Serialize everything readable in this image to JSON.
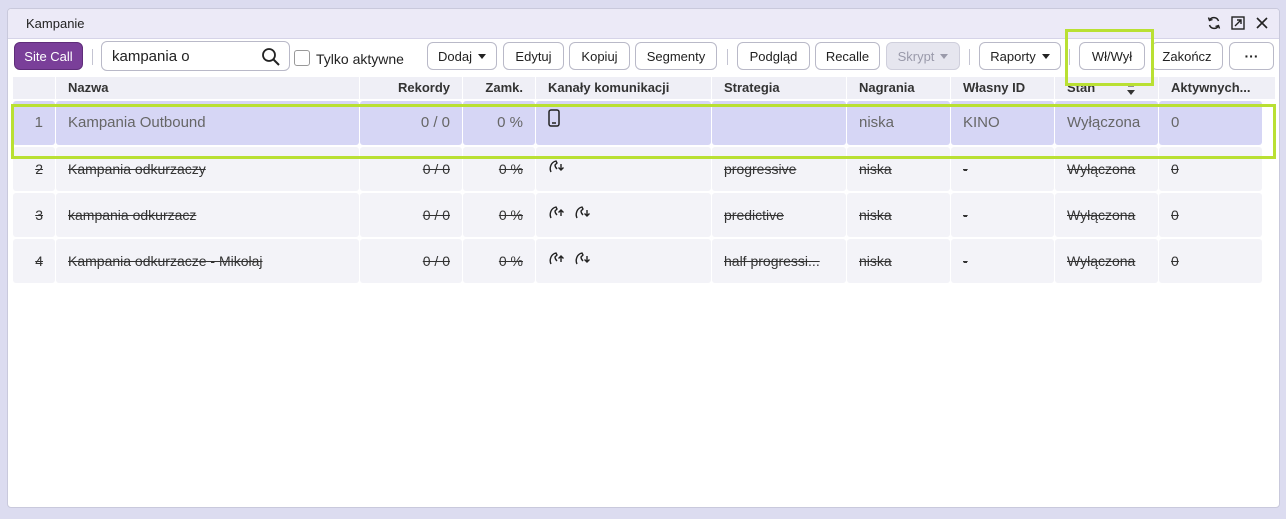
{
  "window": {
    "title": "Kampanie"
  },
  "window_controls": [
    "refresh-icon",
    "popout-icon",
    "close-icon"
  ],
  "toolbar": {
    "site_call": "Site Call",
    "search_value": "kampania o",
    "active_only_label": "Tylko aktywne",
    "add": "Dodaj",
    "edit": "Edytuj",
    "copy": "Kopiuj",
    "segments": "Segmenty",
    "preview": "Podgląd",
    "recalle": "Recalle",
    "script": "Skrypt",
    "reports": "Raporty",
    "onoff": "Wł/Wył",
    "finish": "Zakończ",
    "more": "···"
  },
  "columns": {
    "name": "Nazwa",
    "records": "Rekordy",
    "closed": "Zamk.",
    "channels": "Kanały komunikacji",
    "strategy": "Strategia",
    "recordings": "Nagrania",
    "own_id": "Własny ID",
    "state": "Stan",
    "active": "Aktywnych..."
  },
  "rows": [
    {
      "num": "1",
      "name": "Kampania Outbound",
      "records": "0 / 0",
      "closed": "0 %",
      "channels": [
        "mobile-icon"
      ],
      "strategy": "",
      "recordings": "niska",
      "own_id": "KINO",
      "state": "Wyłączona",
      "active": "0"
    },
    {
      "num": "2",
      "name": "Kampania odkurzaczy",
      "records": "0 / 0",
      "closed": "0 %",
      "channels": [
        "phone-inbound-icon"
      ],
      "strategy": "progressive",
      "recordings": "niska",
      "own_id": "-",
      "state": "Wyłączona",
      "active": "0"
    },
    {
      "num": "3",
      "name": "kampania odkurzacz",
      "records": "0 / 0",
      "closed": "0 %",
      "channels": [
        "phone-outbound-icon",
        "phone-inbound-icon"
      ],
      "strategy": "predictive",
      "recordings": "niska",
      "own_id": "-",
      "state": "Wyłączona",
      "active": "0"
    },
    {
      "num": "4",
      "name": "Kampania odkurzacze - Mikołaj",
      "records": "0 / 0",
      "closed": "0 %",
      "channels": [
        "phone-outbound-icon",
        "phone-inbound-icon"
      ],
      "strategy": "half progressi...",
      "recordings": "niska",
      "own_id": "-",
      "state": "Wyłączona",
      "active": "0"
    }
  ],
  "colors": {
    "accent": "#7a3f99",
    "selected_row": "#d6d6f5",
    "highlight": "#b9e033"
  }
}
